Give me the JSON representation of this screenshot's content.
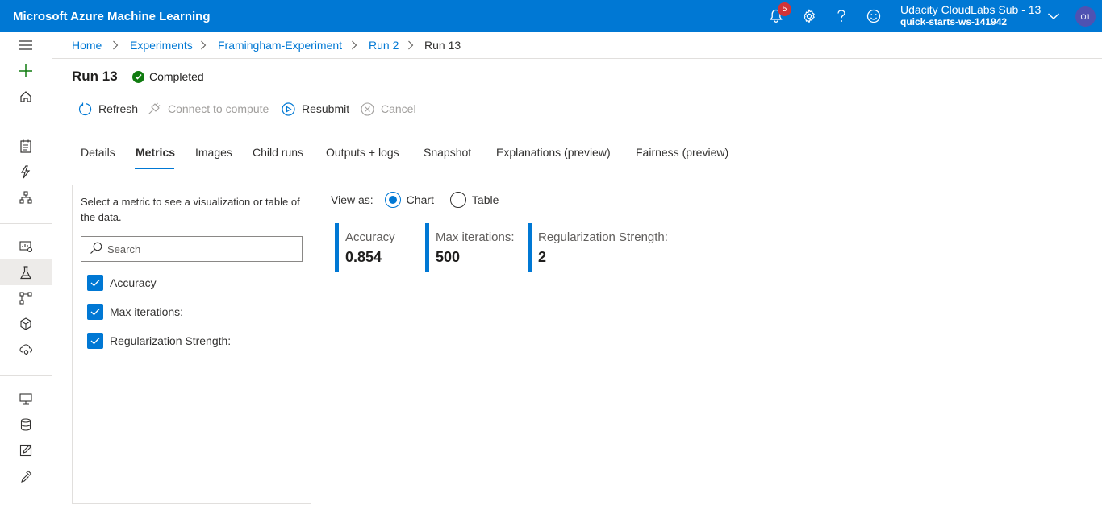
{
  "app": {
    "title": "Microsoft Azure Machine Learning",
    "notification_count": "5",
    "account_name": "Udacity CloudLabs Sub - 13",
    "workspace": "quick-starts-ws-141942",
    "avatar_initials": "O1",
    "accent_color": "#0078d4"
  },
  "breadcrumb": [
    "Home",
    "Experiments",
    "Framingham-Experiment",
    "Run 2",
    "Run 13"
  ],
  "run": {
    "title": "Run 13",
    "status": "Completed",
    "status_color": "#107c10"
  },
  "commands": {
    "refresh": "Refresh",
    "connect": "Connect to compute",
    "resubmit": "Resubmit",
    "cancel": "Cancel"
  },
  "tabs": [
    "Details",
    "Metrics",
    "Images",
    "Child runs",
    "Outputs + logs",
    "Snapshot",
    "Explanations (preview)",
    "Fairness (preview)"
  ],
  "active_tab": "Metrics",
  "metrics_panel": {
    "description": "Select a metric to see a visualization or table of the data.",
    "search_placeholder": "Search",
    "items": [
      "Accuracy",
      "Max iterations:",
      "Regularization Strength:"
    ]
  },
  "view_as": {
    "label": "View as:",
    "chart": "Chart",
    "table": "Table",
    "selected": "Chart"
  },
  "metric_cards": [
    {
      "name": "Accuracy",
      "value": "0.854"
    },
    {
      "name": "Max iterations:",
      "value": "500"
    },
    {
      "name": "Regularization Strength:",
      "value": "2"
    }
  ]
}
